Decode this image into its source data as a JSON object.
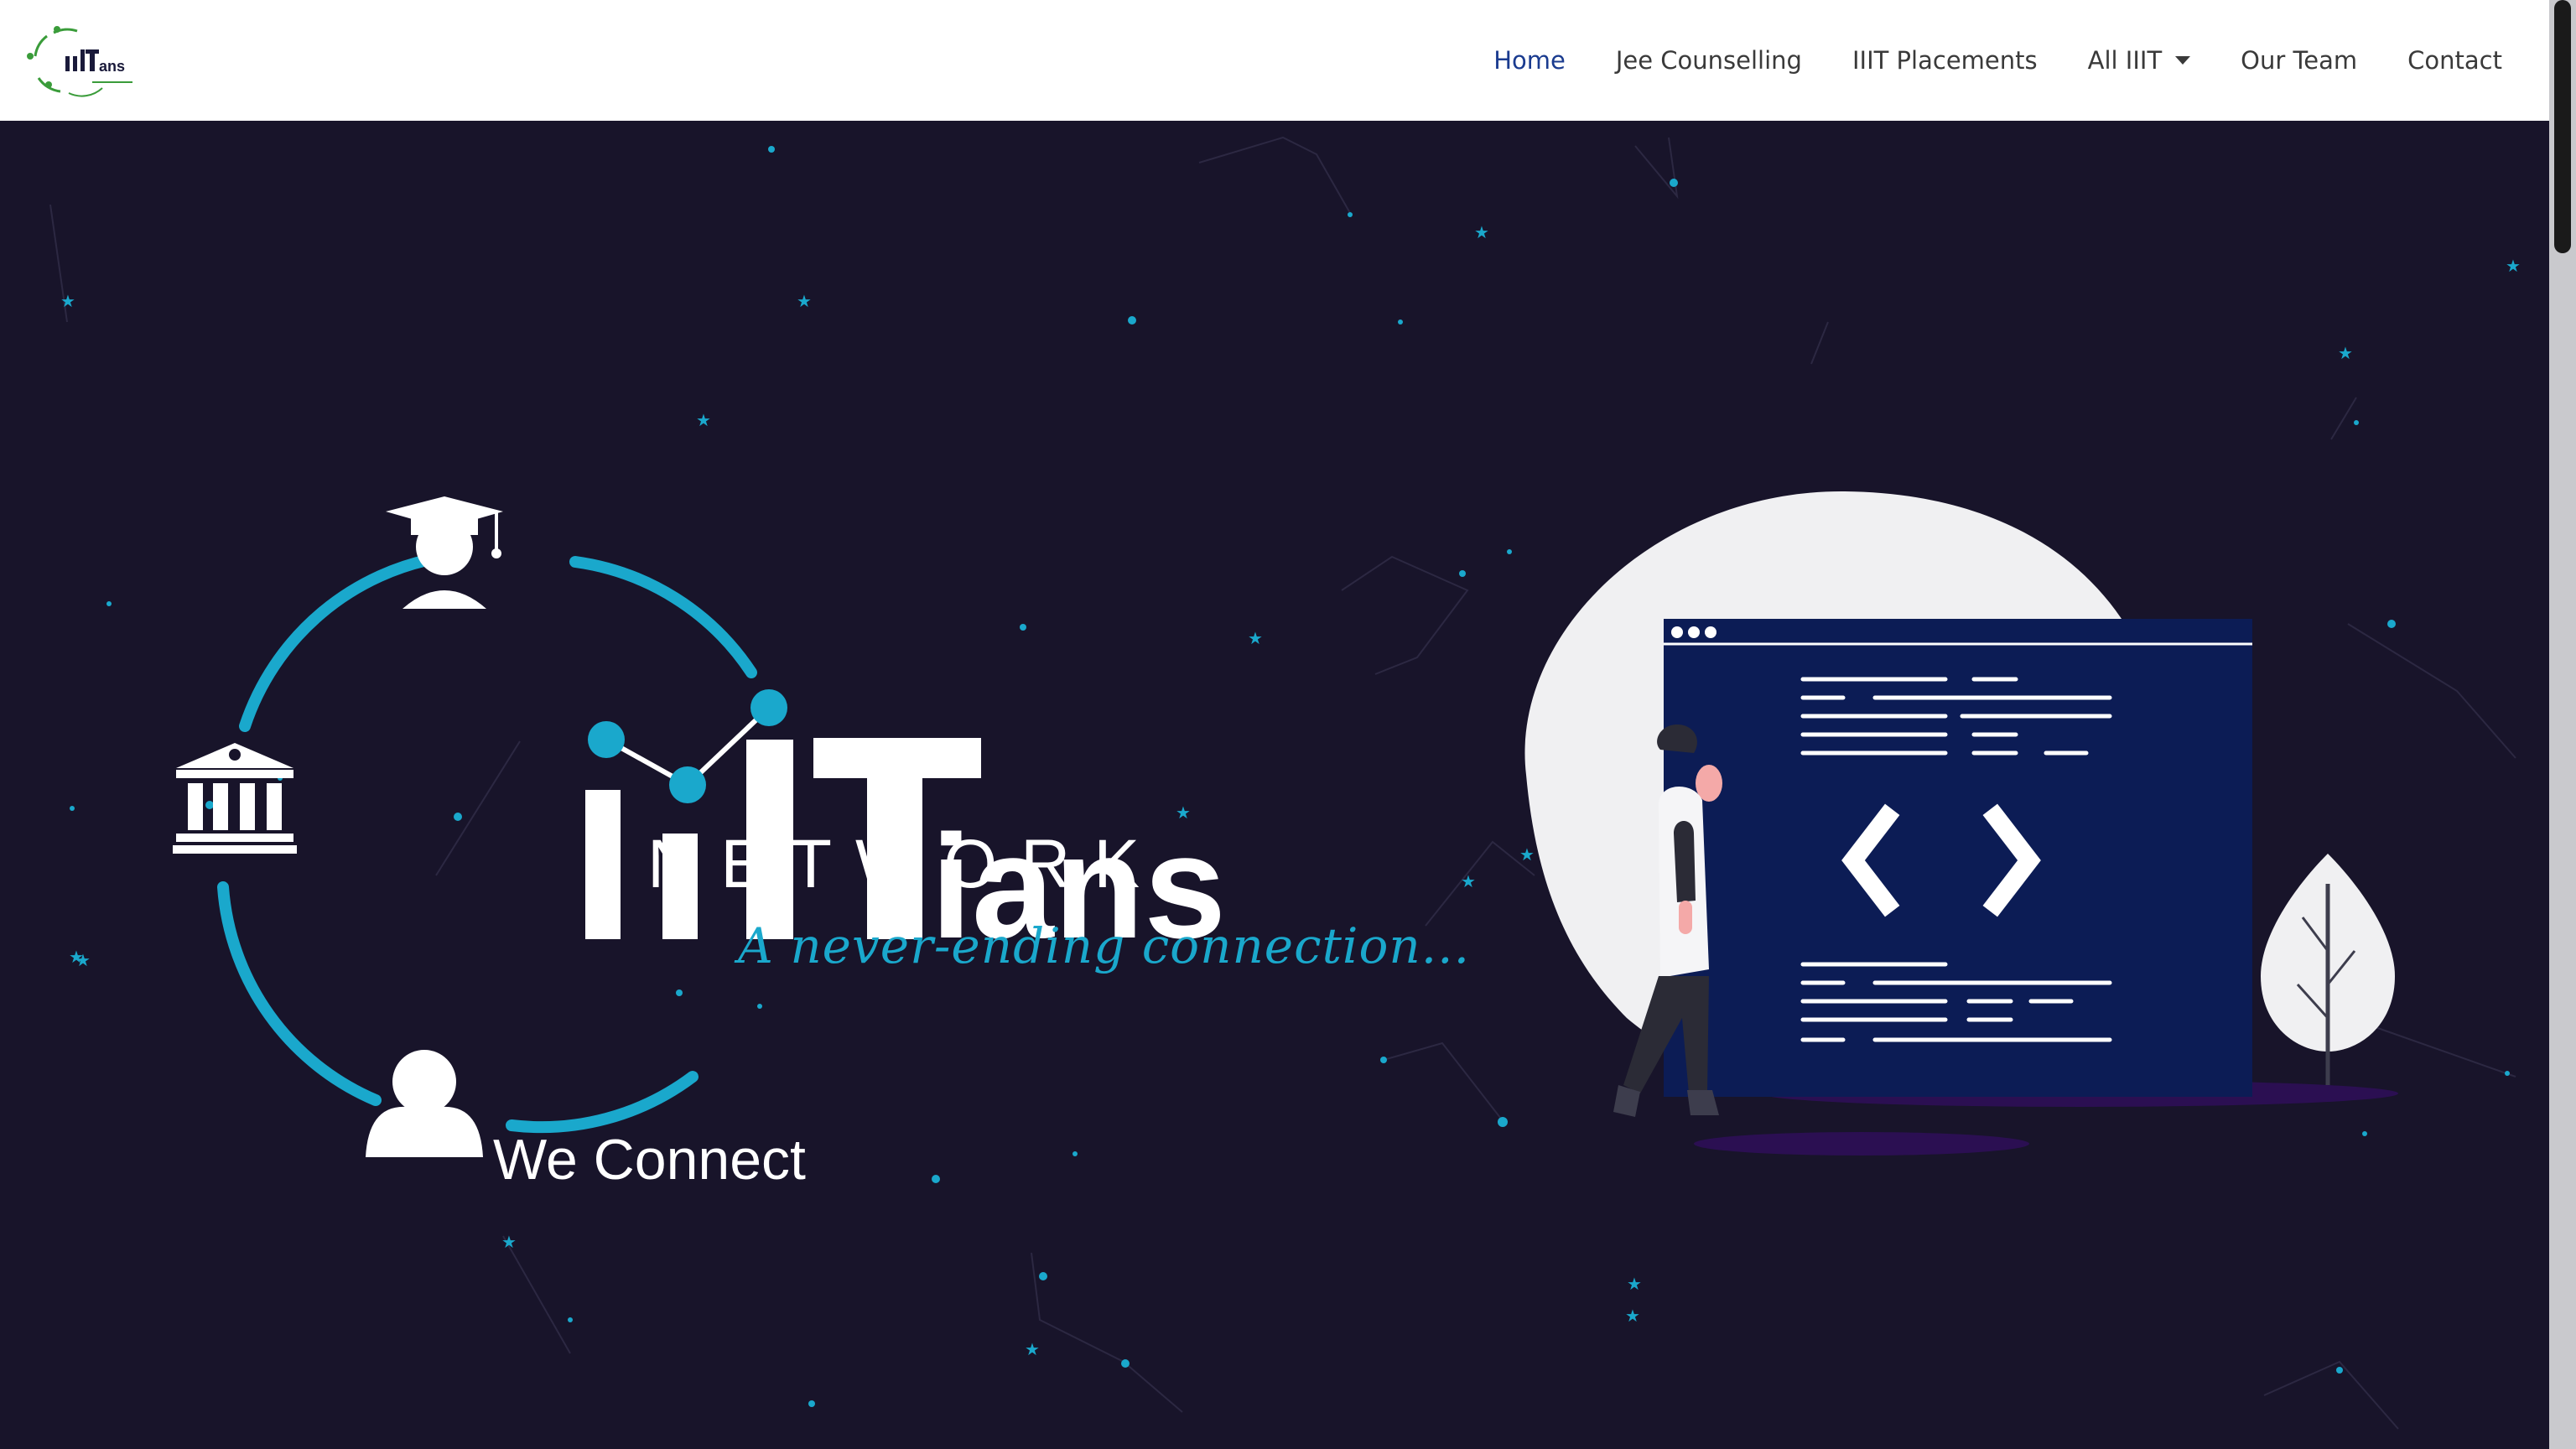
{
  "brand": {
    "logo_text": "IIITians",
    "logo_icon": "iiitians-network-logo"
  },
  "nav": {
    "items": [
      {
        "label": "Home",
        "active": true
      },
      {
        "label": "Jee Counselling",
        "active": false
      },
      {
        "label": "IIIT Placements",
        "active": false
      },
      {
        "label": "All IIIT",
        "active": false,
        "dropdown": true
      },
      {
        "label": "Our Team",
        "active": false
      },
      {
        "label": "Contact",
        "active": false
      }
    ]
  },
  "hero": {
    "logo_main": "IIITians",
    "logo_sub": "NETWORK",
    "tagline": "A never-ending connection...",
    "headline": "We Connect",
    "icons": [
      "graduate-icon",
      "institution-icon",
      "user-icon"
    ],
    "illustration": "developer-code-window-illustration"
  },
  "colors": {
    "background": "#18142a",
    "accent": "#1aa8cc",
    "nav_active": "#1a3b8f",
    "code_window": "#0c1c55",
    "blob": "#f0f0f2"
  }
}
